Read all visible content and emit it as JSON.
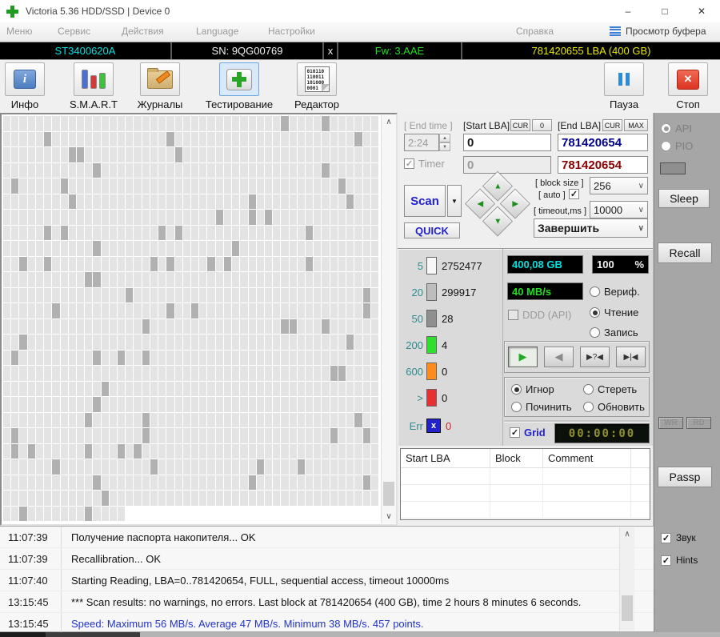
{
  "icons": {
    "minimize": "–",
    "maximize": "□",
    "close": "✕",
    "check": "✓",
    "chevron_down": "∨",
    "dropdown_arrow": "▼",
    "spin_up": "▲",
    "spin_down": "▼",
    "arrow_up": "▲",
    "arrow_right": "▶",
    "arrow_left": "◀",
    "arrow_down": "▼",
    "scroll_up": "∧",
    "scroll_down": "∨",
    "play": "▶",
    "rewind": "◀",
    "seek_question": "▶?◀",
    "seek_pause": "▶|◀",
    "info_i": "i",
    "stop_x": "✕",
    "err_x": "x"
  },
  "window": {
    "title": "Victoria 5.36 HDD/SSD | Device 0"
  },
  "menu": {
    "items": [
      {
        "label": "Меню"
      },
      {
        "label": "Сервис"
      },
      {
        "label": "Действия"
      },
      {
        "label": "Language"
      },
      {
        "label": "Настройки"
      },
      {
        "label": "Справка"
      }
    ],
    "buffer_view": "Просмотр буфера"
  },
  "device_bar": {
    "model": "ST3400620A",
    "model_color": "#00e0e0",
    "serial": "SN: 9QG00769",
    "serial_color": "#f0f0f0",
    "x_flag": "x",
    "x_color": "#f0f0f0",
    "firmware": "Fw: 3.AAE",
    "firmware_color": "#22dd22",
    "capacity": "781420655 LBA (400 GB)",
    "capacity_color": "#e8e800"
  },
  "toolbar": {
    "buttons": [
      {
        "label": "Инфо"
      },
      {
        "label": "S.M.A.R.T"
      },
      {
        "label": "Журналы"
      },
      {
        "label": "Тестирование"
      },
      {
        "label": "Редактор"
      }
    ],
    "pause_label": "Пауза",
    "stop_label": "Стоп",
    "editor_icon_lines": [
      "010110",
      "110011",
      "101000",
      "0001"
    ]
  },
  "scan_map": {
    "cols": 46,
    "rows": 26,
    "partial_last_row_cells": 15,
    "dark_fraction": 0.06,
    "seed": 1337,
    "cell_color": "#e3e3e3",
    "dark_color": "#b1b1b1"
  },
  "controls": {
    "end_time_label": "[ End time ]",
    "end_time": "2:24",
    "start_lba_label": "[Start LBA]",
    "cur_label": "CUR",
    "zero_label": "0",
    "end_lba_label": "[End LBA]",
    "max_label": "MAX",
    "start_lba": "0",
    "start_lba_2": "0",
    "end_lba": "781420654",
    "end_lba_2": "781420654",
    "end_lba_color": "#00008b",
    "end_lba_2_color": "#8b0000",
    "timer_label": "Timer",
    "scan_label": "Scan",
    "scan_color": "#2222cc",
    "quick_label": "QUICK",
    "block_size_label": "[ block size ]",
    "auto_label": "[ auto ]",
    "block_size": "256",
    "timeout_label": "[ timeout,ms ]",
    "timeout": "10000",
    "action_selected": "Завершить"
  },
  "stats": {
    "rows": [
      {
        "label": "5",
        "count": "2752477",
        "color": "#f7f7f7",
        "count_color": "#111111"
      },
      {
        "label": "20",
        "count": "299917",
        "color": "#bdbdbd",
        "count_color": "#111111"
      },
      {
        "label": "50",
        "count": "28",
        "color": "#8f8f8f",
        "count_color": "#111111"
      },
      {
        "label": "200",
        "count": "4",
        "color": "#2ee02e",
        "count_color": "#111111"
      },
      {
        "label": "600",
        "count": "0",
        "color": "#ff8c1a",
        "count_color": "#111111"
      },
      {
        "label": ">",
        "count": "0",
        "color": "#e83030",
        "count_color": "#111111"
      },
      {
        "label": "Err",
        "count": "0",
        "color": "#2222cc",
        "count_color": "#cc2222"
      }
    ]
  },
  "readout": {
    "size": "400,08 GB",
    "size_color": "#00e0e0",
    "percent": "100",
    "percent_unit": "%",
    "percent_color": "#f0f0f0",
    "speed": "40 MB/s",
    "speed_color": "#22dd22",
    "ddd_label": "DDD (API)",
    "mode_options": [
      {
        "label": "Вериф."
      },
      {
        "label": "Чтение"
      },
      {
        "label": "Запись"
      }
    ],
    "remedy_options": [
      {
        "label": "Игнор"
      },
      {
        "label": "Стереть"
      },
      {
        "label": "Починить"
      },
      {
        "label": "Обновить"
      }
    ],
    "grid_label": "Grid",
    "grid_color": "#2222cc",
    "timer_lcd": "00:00:00"
  },
  "defect_table": {
    "columns": [
      {
        "label": "Start LBA"
      },
      {
        "label": "Block"
      },
      {
        "label": "Comment"
      }
    ]
  },
  "sidebar": {
    "api_label": "API",
    "pio_label": "PIO",
    "sleep_label": "Sleep",
    "recall_label": "Recall",
    "wr_label": "WR",
    "rd_label": "RD",
    "passp_label": "Passp",
    "sound_label": "Звук",
    "hints_label": "Hints"
  },
  "log": {
    "entries": [
      {
        "time": "11:07:39",
        "text": "Получение паспорта накопителя... OK",
        "color": "#111111"
      },
      {
        "time": "11:07:39",
        "text": "Recallibration... OK",
        "color": "#111111"
      },
      {
        "time": "11:07:40",
        "text": "Starting Reading, LBA=0..781420654, FULL, sequential access, timeout 10000ms",
        "color": "#111111"
      },
      {
        "time": "13:15:45",
        "text": "*** Scan results: no warnings, no errors. Last block at 781420654 (400 GB), time 2 hours 8 minutes 6 seconds.",
        "color": "#111111"
      },
      {
        "time": "13:15:45",
        "text": "Speed: Maximum 56 MB/s. Average 47 MB/s. Minimum 38 MB/s. 457 points.",
        "color": "#2233cc"
      }
    ]
  }
}
